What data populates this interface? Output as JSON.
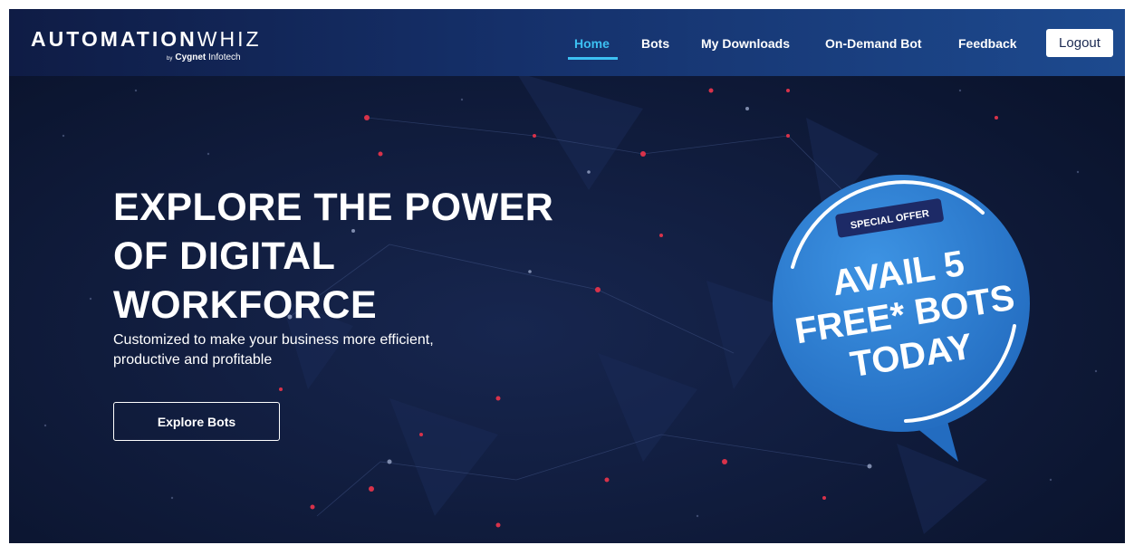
{
  "brand": {
    "name_bold": "AUTOMATION",
    "name_light": "WHIZ",
    "by": "by",
    "sub_bold": "Cygnet",
    "sub_light": "Infotech"
  },
  "nav": {
    "items": [
      {
        "label": "Home",
        "active": true
      },
      {
        "label": "Bots",
        "active": false
      },
      {
        "label": "My Downloads",
        "active": false
      },
      {
        "label": "On-Demand Bot",
        "active": false
      },
      {
        "label": "Feedback",
        "active": false
      }
    ],
    "logout_label": "Logout"
  },
  "hero": {
    "title_lines": [
      "EXPLORE THE POWER",
      "OF DIGITAL",
      "WORKFORCE"
    ],
    "subtitle_lines": [
      "Customized to make your business more efficient,",
      "productive and profitable"
    ],
    "cta_label": "Explore Bots"
  },
  "offer": {
    "tag": "SPECIAL OFFER",
    "lines": [
      "AVAIL 5",
      "FREE* BOTS",
      "TODAY"
    ]
  },
  "colors": {
    "background": "#0c1633",
    "nav_active": "#3cc0f2",
    "badge_blue": "#2f7fd3",
    "badge_tag": "#1d2a66",
    "network_dot": "#d8324a"
  },
  "icons": {
    "badge": "speech-bubble-badge-icon",
    "background": "network-particles-decoration"
  }
}
